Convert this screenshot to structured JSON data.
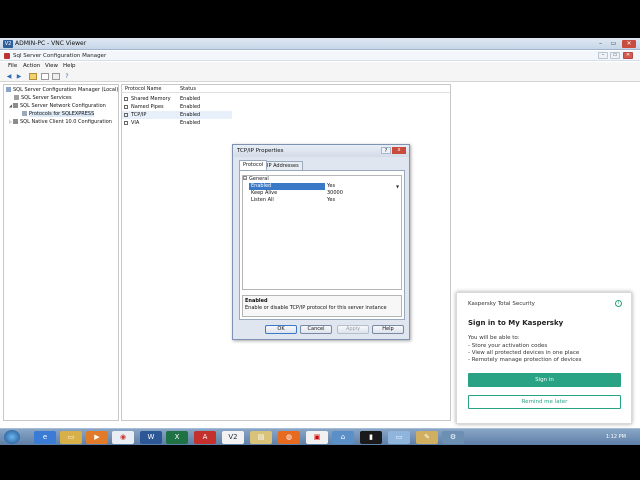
{
  "vnc": {
    "title": "ADMIN-PC - VNC Viewer",
    "logo": "V2"
  },
  "app": {
    "title": "Sql Server Configuration Manager",
    "menu": [
      "File",
      "Action",
      "View",
      "Help"
    ]
  },
  "tree": {
    "items": [
      "SQL Server Configuration Manager (Local)",
      "SQL Server Services",
      "SQL Server Network Configuration",
      "Protocols for SQLEXPRESS",
      "SQL Native Client 10.0 Configuration"
    ]
  },
  "list": {
    "headers": [
      "Protocol Name",
      "Status"
    ],
    "rows": [
      {
        "name": "Shared Memory",
        "status": "Enabled"
      },
      {
        "name": "Named Pipes",
        "status": "Enabled"
      },
      {
        "name": "TCP/IP",
        "status": "Enabled"
      },
      {
        "name": "VIA",
        "status": "Enabled"
      }
    ]
  },
  "dialog": {
    "title": "TCP/IP Properties",
    "help": "?",
    "close": "x",
    "tabs": [
      "Protocol",
      "IP Addresses"
    ],
    "group": "General",
    "props": [
      {
        "key": "Enabled",
        "value": "Yes"
      },
      {
        "key": "Keep Alive",
        "value": "30000"
      },
      {
        "key": "Listen All",
        "value": "Yes"
      }
    ],
    "desc_title": "Enabled",
    "desc_text": "Enable or disable TCP/IP protocol for this server instance",
    "buttons": [
      "OK",
      "Cancel",
      "Apply",
      "Help"
    ]
  },
  "toast": {
    "brand": "Kaspersky Total Security",
    "heading": "Sign in to My Kaspersky",
    "intro": "You will be able to:",
    "bullets": [
      "- Store your activation codes",
      "- View all protected devices in one place",
      "- Remotely manage protection of devices"
    ],
    "primary": "Sign in",
    "secondary": "Remind me later"
  },
  "taskbar": {
    "clock": "1:12 PM",
    "apps": [
      "ie-icon",
      "folder-icon",
      "media-player-icon",
      "chrome-icon",
      "word-icon",
      "excel-icon",
      "acrobat-icon",
      "vnc-icon",
      "explorer-icon",
      "firefox-icon",
      "outlook-icon",
      "network-icon",
      "cmd-icon",
      "remote-desktop-icon",
      "paint-icon",
      "tools-icon"
    ]
  },
  "colors": {
    "accent": "#2aa384",
    "selection": "#3a78c8",
    "close": "#c94b3e"
  }
}
